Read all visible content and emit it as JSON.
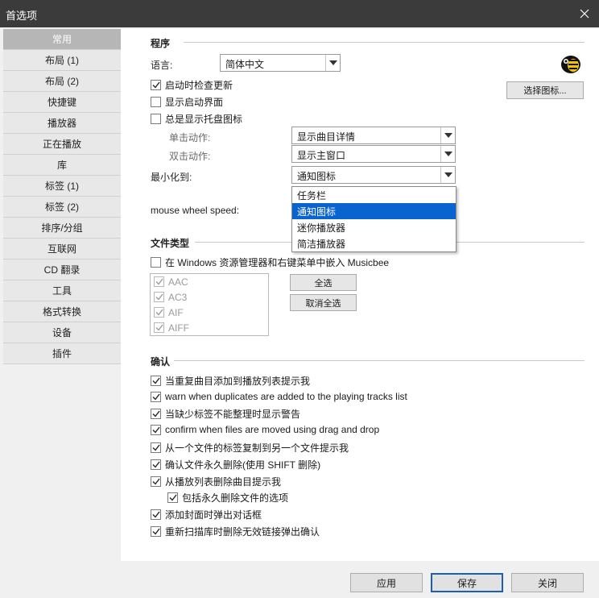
{
  "window": {
    "title": "首选项"
  },
  "sidebar": {
    "items": [
      {
        "label": "常用",
        "active": true
      },
      {
        "label": "布局 (1)"
      },
      {
        "label": "布局 (2)"
      },
      {
        "label": "快捷键"
      },
      {
        "label": "播放器"
      },
      {
        "label": "正在播放"
      },
      {
        "label": "库"
      },
      {
        "label": "标签 (1)"
      },
      {
        "label": "标签 (2)"
      },
      {
        "label": "排序/分组"
      },
      {
        "label": "互联网"
      },
      {
        "label": "CD 翻录"
      },
      {
        "label": "工具"
      },
      {
        "label": "格式转换"
      },
      {
        "label": "设备"
      },
      {
        "label": "插件"
      }
    ]
  },
  "program": {
    "title": "程序",
    "language_label": "语言:",
    "language_value": "简体中文",
    "choose_icon_button": "选择图标...",
    "check_updates": {
      "label": "启动时检查更新",
      "checked": true
    },
    "show_splash": {
      "label": "显示启动界面",
      "checked": false
    },
    "always_tray": {
      "label": "总是显示托盘图标",
      "checked": false
    },
    "single_click_label": "单击动作:",
    "single_click_value": "显示曲目详情",
    "double_click_label": "双击动作:",
    "double_click_value": "显示主窗口",
    "minimize_label": "最小化到:",
    "minimize_value": "通知图标",
    "minimize_options": [
      "任务栏",
      "通知图标",
      "迷你播放器",
      "简洁播放器"
    ],
    "mouse_wheel_label": "mouse wheel speed:"
  },
  "file_types": {
    "title": "文件类型",
    "embed": {
      "label": "在 Windows 资源管理器和右键菜单中嵌入 Musicbee",
      "checked": false
    },
    "items": [
      {
        "label": "AAC",
        "checked": true
      },
      {
        "label": "AC3",
        "checked": true
      },
      {
        "label": "AIF",
        "checked": true
      },
      {
        "label": "AIFF",
        "checked": true
      }
    ],
    "select_all": "全选",
    "deselect_all": "取消全选"
  },
  "confirm": {
    "title": "确认",
    "items": [
      {
        "label": "当重复曲目添加到播放列表提示我",
        "checked": true
      },
      {
        "label": "warn when duplicates are added to the playing tracks list",
        "checked": true
      },
      {
        "label": "当缺少标签不能整理时显示警告",
        "checked": true
      },
      {
        "label": "confirm when files are moved using drag and drop",
        "checked": true
      },
      {
        "label": "从一个文件的标签复制到另一个文件提示我",
        "checked": true
      },
      {
        "label": "确认文件永久删除(使用 SHIFT 删除)",
        "checked": true
      },
      {
        "label": "从播放列表删除曲目提示我",
        "checked": true
      },
      {
        "label": "包括永久删除文件的选项",
        "checked": true
      },
      {
        "label": "添加封面时弹出对话框",
        "checked": true
      },
      {
        "label": "重新扫描库时删除无效链接弹出确认",
        "checked": true
      }
    ]
  },
  "footer": {
    "apply": "应用",
    "save": "保存",
    "close": "关闭"
  }
}
